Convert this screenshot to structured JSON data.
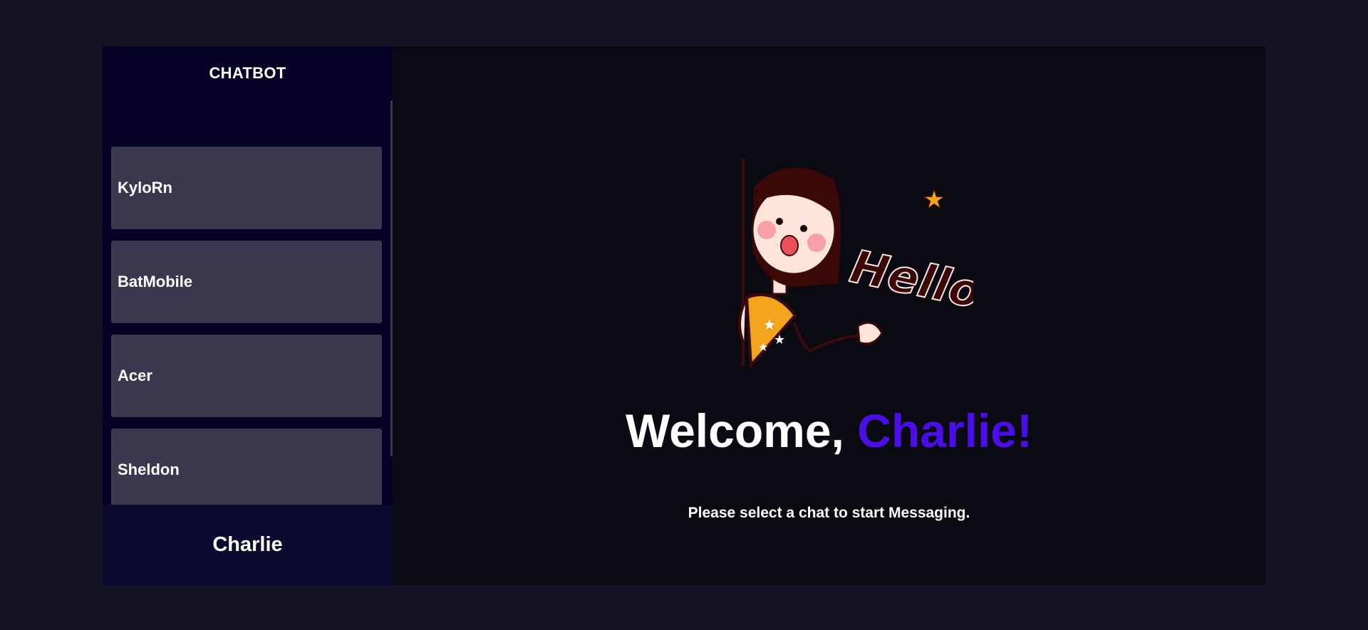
{
  "sidebar": {
    "title": "CHATBOT",
    "chats": [
      {
        "label": "KyloRn"
      },
      {
        "label": "BatMobile"
      },
      {
        "label": "Acer"
      },
      {
        "label": "Sheldon"
      },
      {
        "label": ""
      }
    ],
    "user_name": "Charlie"
  },
  "main": {
    "illustration_text": "Hello",
    "welcome_prefix": "Welcome,",
    "welcome_name": "Charlie!",
    "subtitle": "Please select a chat to start Messaging."
  },
  "colors": {
    "page_bg": "#151424",
    "sidebar_bg": "#050124",
    "chat_item_bg": "#3b374e",
    "user_bar_bg": "#0c0b2f",
    "main_bg": "#0a0a12",
    "accent": "#4b0ee8"
  }
}
